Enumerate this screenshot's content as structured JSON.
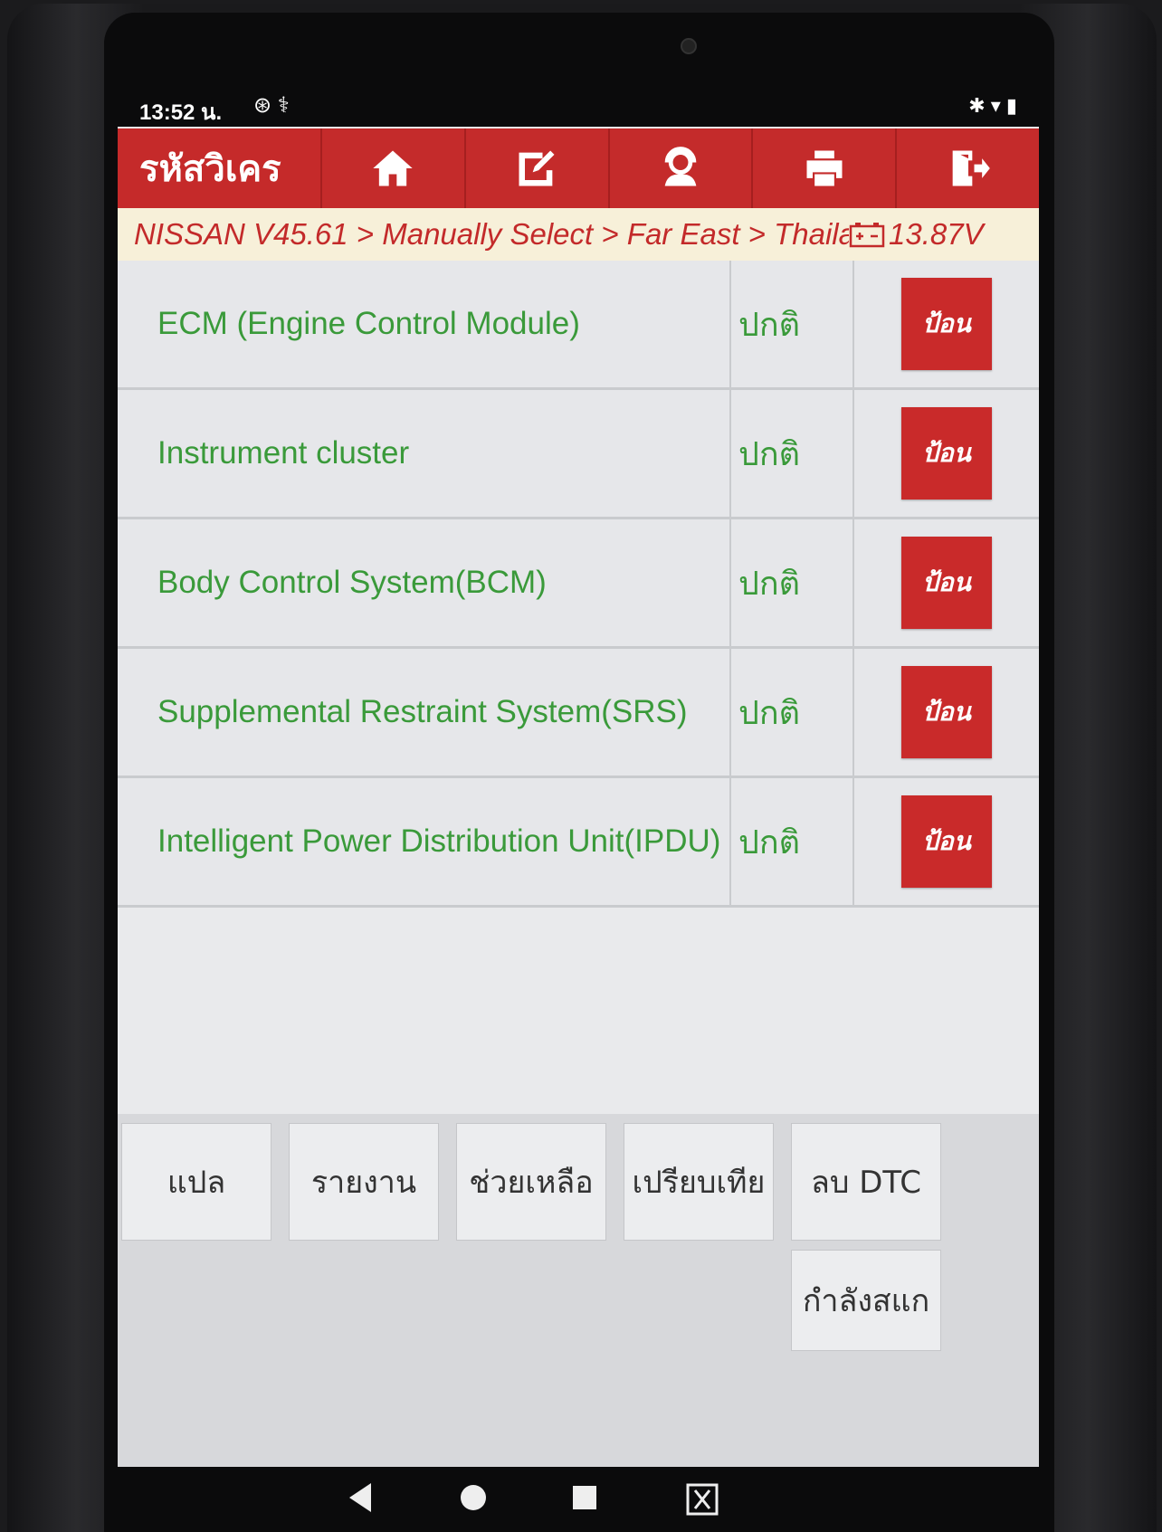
{
  "status_bar": {
    "time": "13:52 น.",
    "left_icons": "⊛ ⚕",
    "right_icons": "✱ ▾ ▮"
  },
  "titlebar": {
    "title": "รหัสวิเคร",
    "buttons": [
      {
        "icon": "home-icon"
      },
      {
        "icon": "edit-icon"
      },
      {
        "icon": "support-icon"
      },
      {
        "icon": "print-icon"
      },
      {
        "icon": "exit-icon"
      }
    ]
  },
  "breadcrumb": {
    "path": "NISSAN V45.61 > Manually Select > Far East > Thaila...",
    "voltage": "13.87V"
  },
  "modules": [
    {
      "name": "ECM (Engine Control Module)",
      "status": "ปกติ",
      "action": "ป้อน"
    },
    {
      "name": "Instrument cluster",
      "status": "ปกติ",
      "action": "ป้อน"
    },
    {
      "name": "Body Control System(BCM)",
      "status": "ปกติ",
      "action": "ป้อน"
    },
    {
      "name": "Supplemental Restraint System(SRS)",
      "status": "ปกติ",
      "action": "ป้อน"
    },
    {
      "name": "Intelligent Power Distribution Unit(IPDU)",
      "status": "ปกติ",
      "action": "ป้อน"
    }
  ],
  "footer_buttons": {
    "translate": "แปล",
    "report": "รายงาน",
    "help": "ช่วยเหลือ",
    "compare": "เปรียบเทีย",
    "clear_dtc": "ลบ DTC",
    "scanning": "กำลังสแก"
  },
  "colors": {
    "accent_red": "#c52a2a",
    "ok_green": "#3a9a3a",
    "breadcrumb_bg": "#f7f0d9"
  }
}
